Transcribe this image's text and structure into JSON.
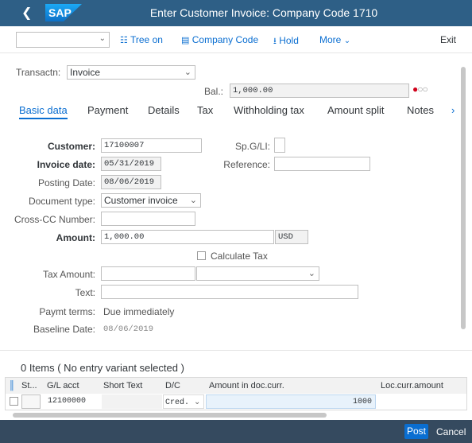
{
  "window": {
    "title": "Enter Customer Invoice: Company Code 1710",
    "logo_text": "SAP",
    "back_icon": "chevron-left-icon"
  },
  "toolbar": {
    "variant_value": "",
    "tree_on": "Tree on",
    "company_code": "Company Code",
    "hold": "Hold",
    "more": "More",
    "exit": "Exit"
  },
  "header": {
    "transaction_label": "Transactn:",
    "transaction_value": "Invoice",
    "balance_label": "Bal.:",
    "balance_value": "1,000.00",
    "status_icon": "red-light-icon"
  },
  "tabs": [
    {
      "label": "Basic data",
      "active": true
    },
    {
      "label": "Payment",
      "active": false
    },
    {
      "label": "Details",
      "active": false
    },
    {
      "label": "Tax",
      "active": false
    },
    {
      "label": "Withholding tax",
      "active": false
    },
    {
      "label": "Amount split",
      "active": false
    },
    {
      "label": "Notes",
      "active": false
    }
  ],
  "form": {
    "customer_label": "Customer:",
    "customer_value": "17100007",
    "spgl_label": "Sp.G/LI:",
    "spgl_value": "",
    "invoice_date_label": "Invoice date:",
    "invoice_date_value": "05/31/2019",
    "reference_label": "Reference:",
    "reference_value": "",
    "posting_date_label": "Posting Date:",
    "posting_date_value": "08/06/2019",
    "doc_type_label": "Document type:",
    "doc_type_value": "Customer invoice",
    "cross_cc_label": "Cross-CC Number:",
    "cross_cc_value": "",
    "amount_label": "Amount:",
    "amount_value": "1,000.00",
    "currency_value": "USD",
    "calculate_tax_label": "Calculate Tax",
    "tax_amount_label": "Tax Amount:",
    "tax_amount_value": "",
    "tax_code_value": "",
    "text_label": "Text:",
    "text_value": "",
    "paymt_terms_label": "Paymt terms:",
    "paymt_terms_value": "Due immediately",
    "baseline_date_label": "Baseline Date:",
    "baseline_date_value": "08/06/2019"
  },
  "items": {
    "title": "0 Items ( No entry variant selected )",
    "columns": [
      "St...",
      "G/L acct",
      "Short Text",
      "D/C",
      "Amount in doc.curr.",
      "Loc.curr.amount"
    ],
    "rows": [
      {
        "status": "",
        "gl_acct": "12100000",
        "short_text": "",
        "dc": "Cred.",
        "amount": "1000",
        "loc_amount": ""
      }
    ]
  },
  "footer": {
    "post": "Post",
    "cancel": "Cancel"
  }
}
